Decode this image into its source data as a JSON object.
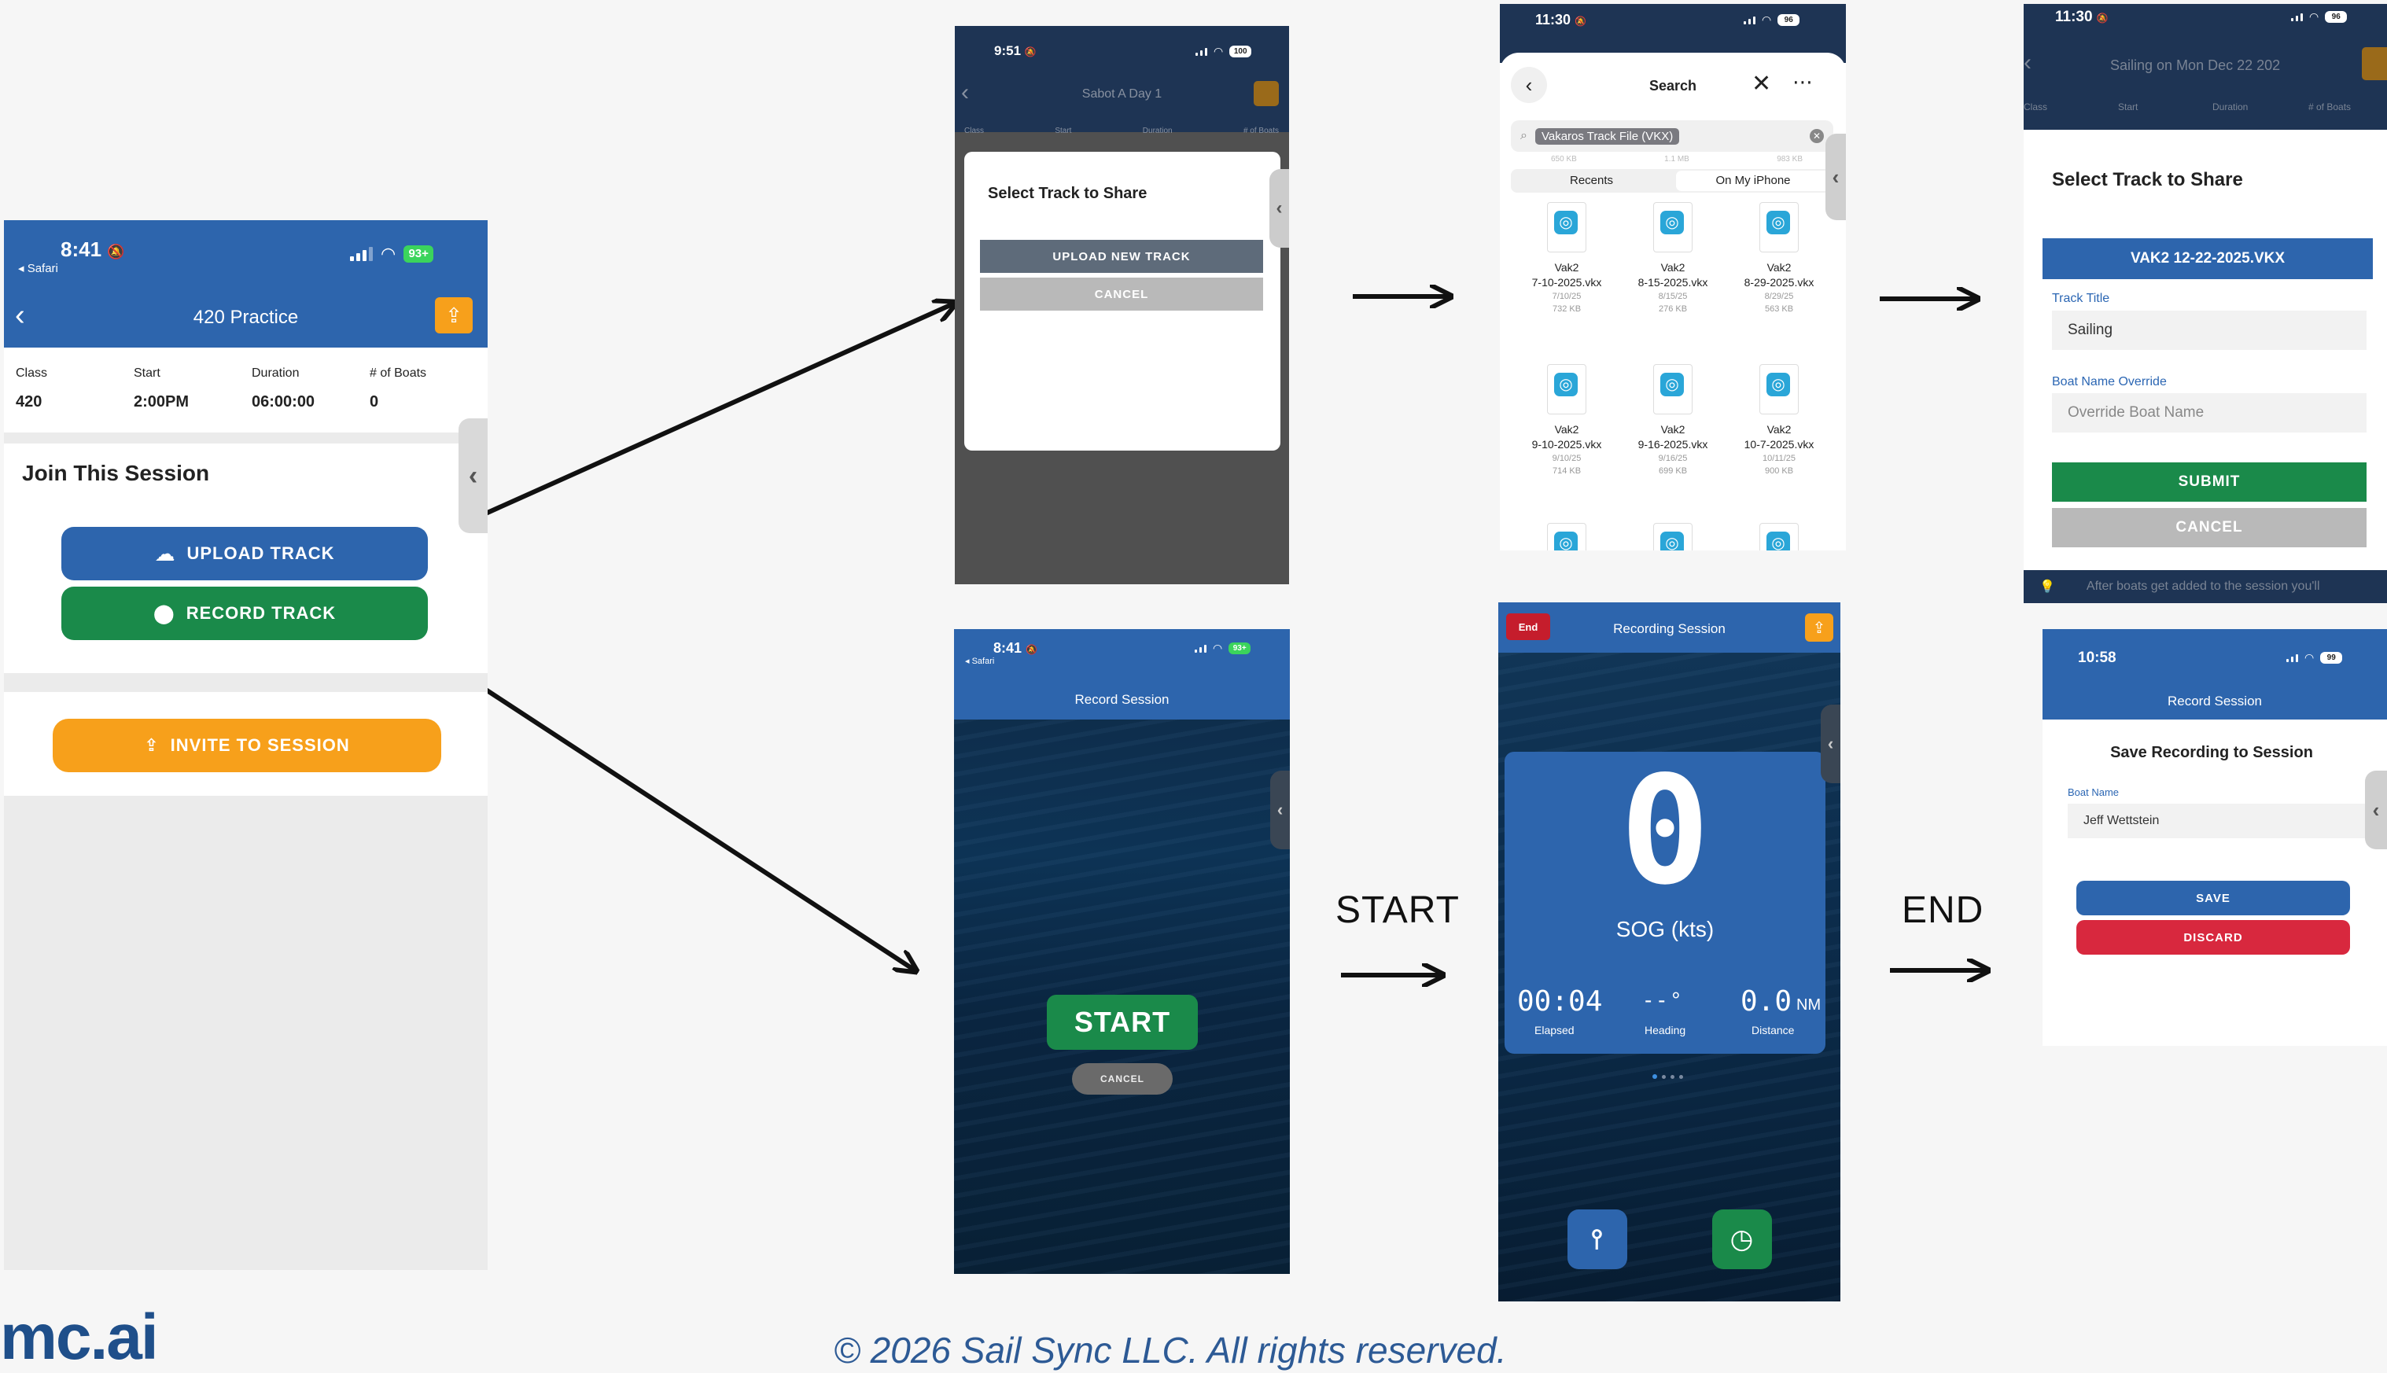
{
  "colors": {
    "blue": "#2d65ad",
    "green": "#1a8a4a",
    "orange": "#f7a01b",
    "red": "#d8283e",
    "gray_btn": "#b9b9b9",
    "dark_btn": "#5e6b7a"
  },
  "screen1": {
    "time": "8:41",
    "back_app": "◂ Safari",
    "battery": "93+",
    "title": "420 Practice",
    "info_headers": [
      "Class",
      "Start",
      "Duration",
      "# of Boats"
    ],
    "info_values": [
      "420",
      "2:00PM",
      "06:00:00",
      "0"
    ],
    "section_title": "Join This Session",
    "upload_label": "UPLOAD TRACK",
    "record_label": "RECORD TRACK",
    "invite_label": "INVITE TO SESSION"
  },
  "screen2": {
    "time": "9:51",
    "battery": "100",
    "title": "Sabot A Day 1",
    "info_headers": [
      "Class",
      "Start",
      "Duration",
      "# of Boats"
    ],
    "modal_title": "Select Track to Share",
    "upload_new": "UPLOAD NEW TRACK",
    "cancel": "CANCEL"
  },
  "screen3": {
    "time": "11:30",
    "battery": "96",
    "title": "Search",
    "search_token": "Vakaros Track File (VKX)",
    "size_row": [
      "650 KB",
      "1.1 MB",
      "983 KB"
    ],
    "tab_recents": "Recents",
    "tab_on_my_iphone": "On My iPhone",
    "files": [
      {
        "name": "Vak2\n7-10-2025.vkx",
        "date": "7/10/25",
        "size": "732 KB"
      },
      {
        "name": "Vak2\n8-15-2025.vkx",
        "date": "8/15/25",
        "size": "276 KB"
      },
      {
        "name": "Vak2\n8-29-2025.vkx",
        "date": "8/29/25",
        "size": "563 KB"
      },
      {
        "name": "Vak2\n9-10-2025.vkx",
        "date": "9/10/25",
        "size": "714 KB"
      },
      {
        "name": "Vak2\n9-16-2025.vkx",
        "date": "9/16/25",
        "size": "699 KB"
      },
      {
        "name": "Vak2\n10-7-2025.vkx",
        "date": "10/11/25",
        "size": "900 KB"
      }
    ]
  },
  "screen4": {
    "time": "11:30",
    "battery": "96",
    "title": "Sailing on Mon Dec 22 202",
    "info_headers": [
      "Class",
      "Start",
      "Duration",
      "# of Boats"
    ],
    "modal_title": "Select Track to Share",
    "selected_file": "VAK2 12-22-2025.VKX",
    "track_title_label": "Track Title",
    "track_title_value": "Sailing",
    "boat_override_label": "Boat Name Override",
    "boat_override_placeholder": "Override Boat Name",
    "submit": "SUBMIT",
    "cancel": "CANCEL",
    "footer_hint": "After boats get added to the session you'll"
  },
  "screen5": {
    "time": "8:41",
    "back_app": "◂ Safari",
    "battery": "93+",
    "title": "Record Session",
    "start": "START",
    "cancel": "CANCEL"
  },
  "screen6": {
    "end": "End",
    "title": "Recording Session",
    "big_digit": "0",
    "sog_label": "SOG (kts)",
    "elapsed_value": "00:04",
    "elapsed_label": "Elapsed",
    "heading_value": "- - °",
    "heading_label": "Heading",
    "distance_value": "0.0",
    "distance_unit": "NM",
    "distance_label": "Distance"
  },
  "screen7": {
    "time": "10:58",
    "battery": "99",
    "title": "Record Session",
    "modal_title": "Save Recording to Session",
    "boat_name_label": "Boat Name",
    "boat_name_value": "Jeff Wettstein",
    "save": "SAVE",
    "discard": "DISCARD"
  },
  "labels": {
    "start": "START",
    "end": "END"
  },
  "footer": {
    "logo": "mc.ai",
    "copyright": "© 2026 Sail Sync LLC. All rights reserved."
  }
}
